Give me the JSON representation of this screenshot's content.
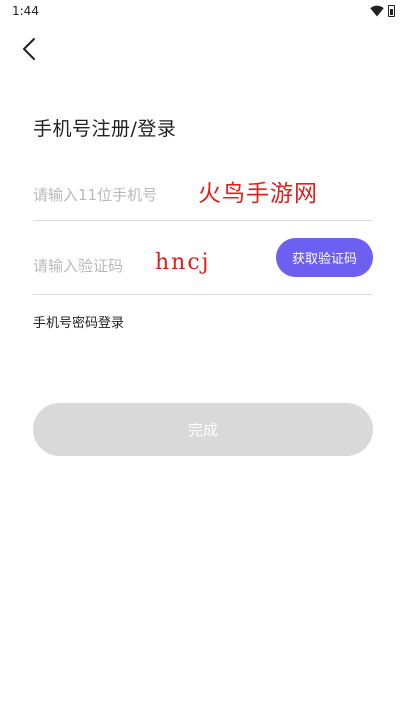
{
  "status_bar": {
    "time": "1:44",
    "icons": [
      "wifi-icon",
      "battery-icon"
    ]
  },
  "header": {
    "back_icon": "chevron-left-icon"
  },
  "title": "手机号注册/登录",
  "phone_field": {
    "placeholder": "请输入11位手机号",
    "value": ""
  },
  "code_field": {
    "placeholder": "请输入验证码",
    "value": ""
  },
  "get_code_button": "获取验证码",
  "password_login_link": "手机号密码登录",
  "submit_button": "完成",
  "watermark": {
    "line1": "火鸟手游网",
    "line2": "hncj",
    "color": "#e0201e"
  },
  "colors": {
    "accent": "#6c5ff2",
    "submit_disabled": "#d9d9d9",
    "divider": "#dcdcdc",
    "placeholder": "#b9b9b9"
  }
}
